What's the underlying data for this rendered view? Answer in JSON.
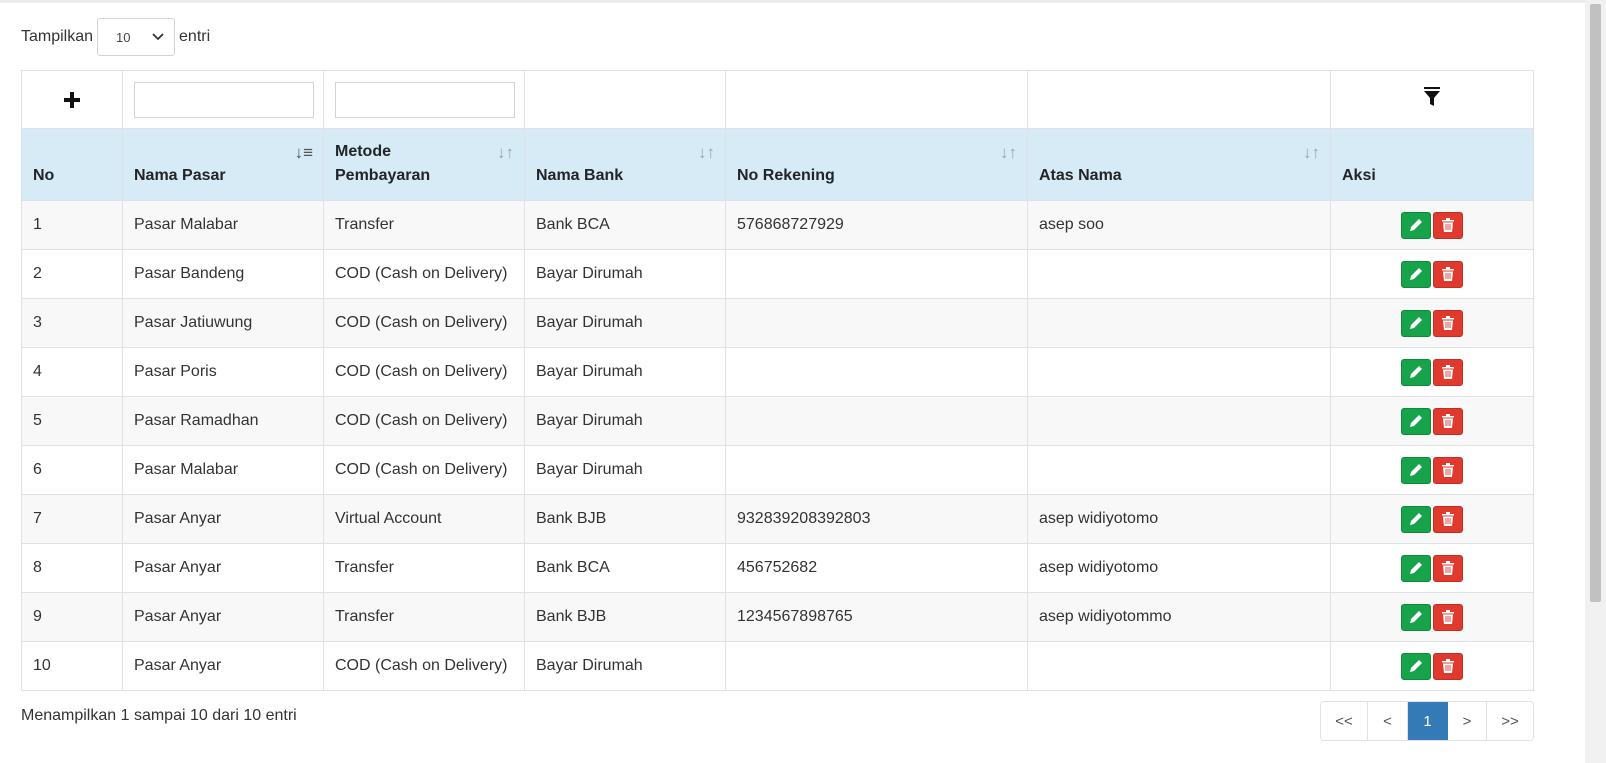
{
  "length_menu": {
    "prefix": "Tampilkan",
    "value": "10",
    "suffix": "entri"
  },
  "table": {
    "columns": [
      "No",
      "Nama Pasar",
      "Metode Pembayaran",
      "Nama Bank",
      "No Rekening",
      "Atas Nama",
      "Aksi"
    ],
    "header_lines": {
      "metode_1": "Metode",
      "metode_2": "Pembayaran"
    },
    "rows": [
      [
        "1",
        "Pasar Malabar",
        "Transfer",
        "Bank BCA",
        "576868727929",
        "asep soo"
      ],
      [
        "2",
        "Pasar Bandeng",
        "COD (Cash on Delivery)",
        "Bayar Dirumah",
        "",
        ""
      ],
      [
        "3",
        "Pasar Jatiuwung",
        "COD (Cash on Delivery)",
        "Bayar Dirumah",
        "",
        ""
      ],
      [
        "4",
        "Pasar Poris",
        "COD (Cash on Delivery)",
        "Bayar Dirumah",
        "",
        ""
      ],
      [
        "5",
        "Pasar Ramadhan",
        "COD (Cash on Delivery)",
        "Bayar Dirumah",
        "",
        ""
      ],
      [
        "6",
        "Pasar Malabar",
        "COD (Cash on Delivery)",
        "Bayar Dirumah",
        "",
        ""
      ],
      [
        "7",
        "Pasar Anyar",
        "Virtual Account",
        "Bank BJB",
        "932839208392803",
        "asep widiyotomo"
      ],
      [
        "8",
        "Pasar Anyar",
        "Transfer",
        "Bank BCA",
        "456752682",
        "asep widiyotomo"
      ],
      [
        "9",
        "Pasar Anyar",
        "Transfer",
        "Bank BJB",
        "1234567898765",
        "asep widiyotommo"
      ],
      [
        "10",
        "Pasar Anyar",
        "COD (Cash on Delivery)",
        "Bayar Dirumah",
        "",
        ""
      ]
    ]
  },
  "icons": {
    "add": "plus-icon",
    "filter": "funnel-icon",
    "edit": "pencil-icon",
    "delete": "trash-icon"
  },
  "colors": {
    "header_bg": "#d6ebf5",
    "edit_btn": "#16a34a",
    "delete_btn": "#e03a2f",
    "active_page": "#337ab7"
  },
  "footer": {
    "info": "Menampilkan 1 sampai 10 dari 10 entri",
    "pagination": [
      "<<",
      "<",
      "1",
      ">",
      ">>"
    ],
    "active_page": "1"
  }
}
